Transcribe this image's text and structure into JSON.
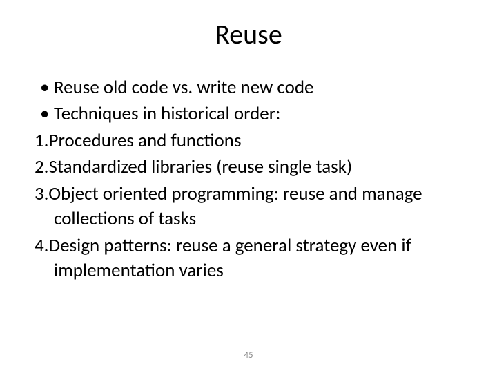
{
  "title": "Reuse",
  "bullets": [
    "Reuse old code vs. write new code",
    "Techniques in historical order:"
  ],
  "numbered": [
    {
      "n": "1.",
      "text": "Procedures and functions"
    },
    {
      "n": "2.",
      "text": "Standardized libraries (reuse single task)"
    },
    {
      "n": "3.",
      "text": "Object oriented programming: reuse and manage collections of tasks"
    },
    {
      "n": "4.",
      "text": "Design patterns: reuse a general strategy even if implementation varies"
    }
  ],
  "pageNumber": "45"
}
